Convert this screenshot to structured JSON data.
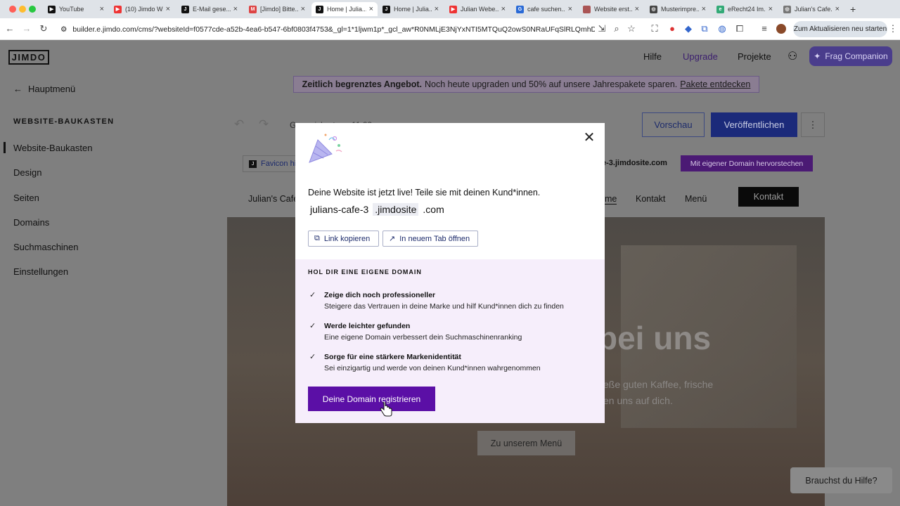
{
  "browser": {
    "tabs": [
      {
        "label": "YouTube",
        "fav_color": "#e33"
      },
      {
        "label": "(10) Jimdo W...",
        "fav_color": "#e33"
      },
      {
        "label": "E-Mail gese...",
        "fav_color": "#111"
      },
      {
        "label": "[Jimdo] Bitte...",
        "fav_color": "#d44"
      },
      {
        "label": "Home | Julia...",
        "fav_color": "#111"
      },
      {
        "label": "Home | Julia...",
        "fav_color": "#111"
      },
      {
        "label": "Julian Webe...",
        "fav_color": "#e33"
      },
      {
        "label": "cafe suchen...",
        "fav_color": "#2a6"
      },
      {
        "label": "Website erst...",
        "fav_color": "#a55"
      },
      {
        "label": "Musterimpre...",
        "fav_color": "#444"
      },
      {
        "label": "eRecht24 Im...",
        "fav_color": "#3a7"
      },
      {
        "label": "Julian's Cafe...",
        "fav_color": "#777"
      }
    ],
    "url": "builder.e.jimdo.com/cms/?websiteId=f0577cde-a52b-4ea6-b547-6bf0803f4753&_gl=1*1ljwm1p*_gcl_aw*R0NMLjE3NjYxNTI5MTQuQ2owS0NRaUFqSlRLQmhDakFS...",
    "update_label": "Zum Aktualisieren neu starten"
  },
  "app": {
    "logo": "JIMDO",
    "nav": {
      "help": "Hilfe",
      "upgrade": "Upgrade",
      "projects": "Projekte",
      "companion": "Frag Companion"
    },
    "promo": {
      "bold": "Zeitlich begrenztes Angebot.",
      "text": "Noch heute upgraden und 50% auf unsere Jahrespakete sparen.",
      "link": "Pakete entdecken"
    },
    "sidebar": {
      "back": "Hauptmenü",
      "heading": "WEBSITE-BAUKASTEN",
      "items": [
        "Website-Baukasten",
        "Design",
        "Seiten",
        "Domains",
        "Suchmaschinen",
        "Einstellungen"
      ]
    },
    "editor": {
      "saved": "Gespeichert um 11:23",
      "preview": "Vorschau",
      "publish": "Veröffentlichen",
      "favicon": "Favicon hi...",
      "domain_suffix": "e-3.jimdosite.com",
      "own_domain_btn": "Mit eigener Domain hervorstechen",
      "site_name": "Julian's Café",
      "site_nav": [
        "me",
        "Kontakt",
        "Menü"
      ],
      "contact_btn": "Kontakt",
      "hero_title": "bei uns",
      "hero_sub1": "eße guten Kaffee, frische",
      "hero_sub2": "en uns auf dich.",
      "menu_btn": "Zu unserem Menü"
    }
  },
  "modal": {
    "live_text": "Deine Website ist jetzt live! Teile sie mit deinen Kund*innen.",
    "domain_parts": [
      "julians-cafe-3",
      ".jimdosite",
      ".com"
    ],
    "copy_link": "Link kopieren",
    "open_tab": "In neuem Tab öffnen",
    "own_domain_heading": "HOL DIR EINE EIGENE DOMAIN",
    "features": [
      {
        "title": "Zeige dich noch professioneller",
        "desc": "Steigere das Vertrauen in deine Marke und hilf Kund*innen dich zu finden"
      },
      {
        "title": "Werde leichter gefunden",
        "desc": "Eine eigene Domain verbessert dein Suchmaschinenranking"
      },
      {
        "title": "Sorge für eine stärkere Markenidentität",
        "desc": "Sei einzigartig und werde von deinen Kund*innen wahrgenommen"
      }
    ],
    "register_btn": "Deine Domain registrieren"
  },
  "help_btn": "Brauchst du Hilfe?"
}
